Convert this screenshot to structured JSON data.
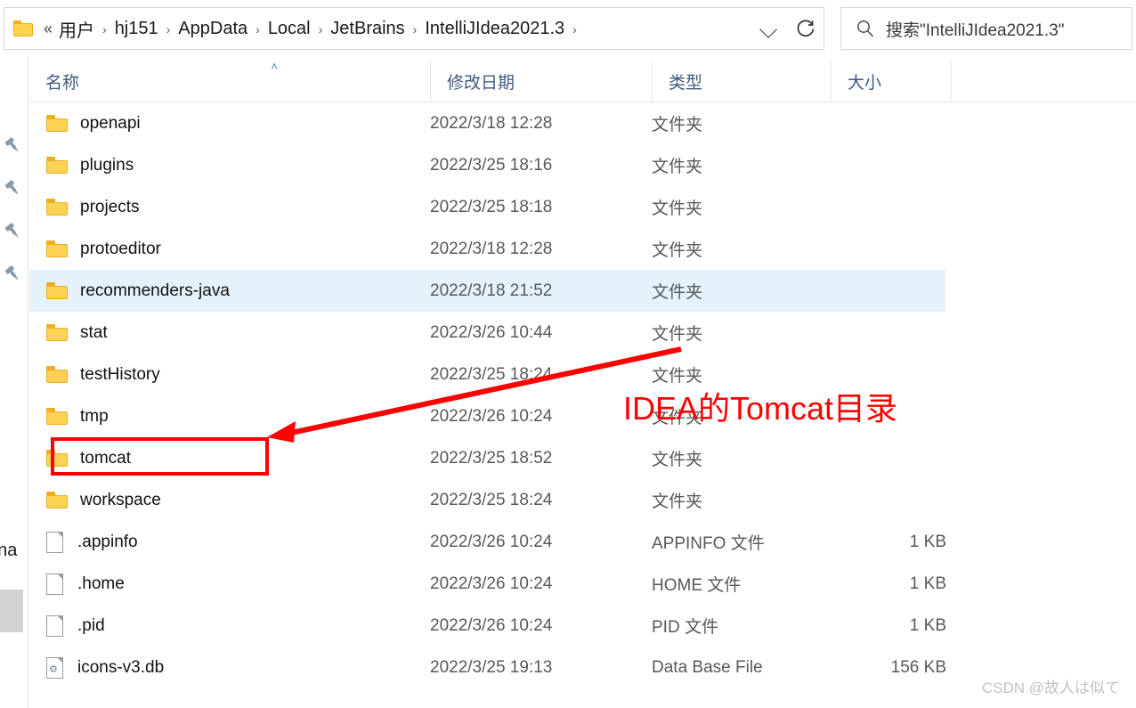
{
  "window": {
    "title": "IntelliJIdea2021.3"
  },
  "addressbar": {
    "folder_icon": "folder-icon",
    "ellipsis": "«",
    "separator": "›",
    "crumbs": [
      "用户",
      "hj151",
      "AppData",
      "Local",
      "JetBrains",
      "IntelliJIdea2021.3"
    ],
    "history_dropdown_icon": "chevron-down-icon",
    "refresh_icon": "refresh-icon"
  },
  "search": {
    "icon": "search-icon",
    "placeholder": "搜索\"IntelliJIdea2021.3\""
  },
  "navpane": {
    "pin_icon": "pin-icon",
    "pin_count": 4,
    "partial_label": "ona",
    "scrollbar_thumb": "scrollbar-thumb"
  },
  "columns": {
    "name": "名称",
    "date_modified": "修改日期",
    "type": "类型",
    "size": "大小",
    "sort_indicator": "˄"
  },
  "rows": [
    {
      "icon": "folder-icon",
      "name": "openapi",
      "date": "2022/3/18 12:28",
      "type": "文件夹",
      "size": "",
      "selected": false
    },
    {
      "icon": "folder-icon",
      "name": "plugins",
      "date": "2022/3/25 18:16",
      "type": "文件夹",
      "size": "",
      "selected": false
    },
    {
      "icon": "folder-icon",
      "name": "projects",
      "date": "2022/3/25 18:18",
      "type": "文件夹",
      "size": "",
      "selected": false
    },
    {
      "icon": "folder-icon",
      "name": "protoeditor",
      "date": "2022/3/18 12:28",
      "type": "文件夹",
      "size": "",
      "selected": false
    },
    {
      "icon": "folder-icon",
      "name": "recommenders-java",
      "date": "2022/3/18 21:52",
      "type": "文件夹",
      "size": "",
      "selected": true
    },
    {
      "icon": "folder-icon",
      "name": "stat",
      "date": "2022/3/26 10:44",
      "type": "文件夹",
      "size": "",
      "selected": false
    },
    {
      "icon": "folder-icon",
      "name": "testHistory",
      "date": "2022/3/25 18:24",
      "type": "文件夹",
      "size": "",
      "selected": false
    },
    {
      "icon": "folder-icon",
      "name": "tmp",
      "date": "2022/3/26 10:24",
      "type": "文件夹",
      "size": "",
      "selected": false
    },
    {
      "icon": "folder-icon",
      "name": "tomcat",
      "date": "2022/3/25 18:52",
      "type": "文件夹",
      "size": "",
      "selected": false
    },
    {
      "icon": "folder-icon",
      "name": "workspace",
      "date": "2022/3/25 18:24",
      "type": "文件夹",
      "size": "",
      "selected": false
    },
    {
      "icon": "file-icon",
      "name": ".appinfo",
      "date": "2022/3/26 10:24",
      "type": "APPINFO 文件",
      "size": "1 KB",
      "selected": false
    },
    {
      "icon": "file-icon",
      "name": ".home",
      "date": "2022/3/26 10:24",
      "type": "HOME 文件",
      "size": "1 KB",
      "selected": false
    },
    {
      "icon": "file-icon",
      "name": ".pid",
      "date": "2022/3/26 10:24",
      "type": "PID 文件",
      "size": "1 KB",
      "selected": false
    },
    {
      "icon": "database-file-icon",
      "name": "icons-v3.db",
      "date": "2022/3/25 19:13",
      "type": "Data Base File",
      "size": "156 KB",
      "selected": false
    }
  ],
  "annotations": {
    "highlight_box_target": "tomcat",
    "arrow_icon": "arrow-pointing-left",
    "label": "IDEA的Tomcat目录",
    "color": "#fe0000"
  },
  "watermark": {
    "text": "CSDN @故人は似て"
  }
}
